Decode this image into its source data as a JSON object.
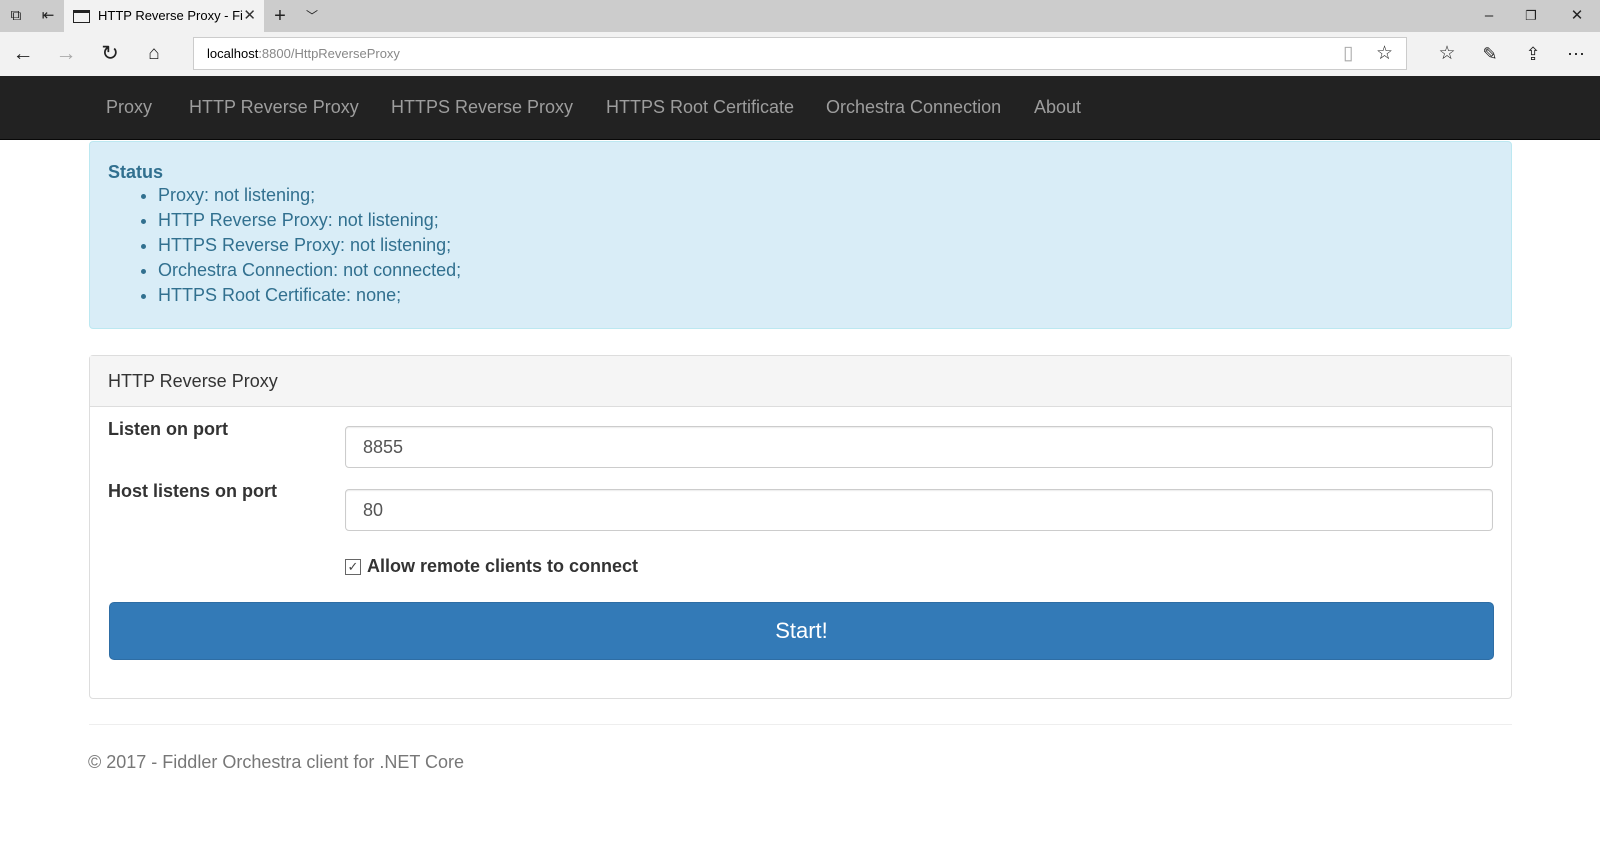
{
  "browser": {
    "tab_title": "HTTP Reverse Proxy - Fi",
    "url_host": "localhost",
    "url_rest": ":8800/HttpReverseProxy"
  },
  "nav": {
    "items": [
      "Proxy",
      "HTTP Reverse Proxy",
      "HTTPS Reverse Proxy",
      "HTTPS Root Certificate",
      "Orchestra Connection",
      "About"
    ]
  },
  "status": {
    "title": "Status",
    "items": [
      "Proxy: not listening;",
      "HTTP Reverse Proxy: not listening;",
      "HTTPS Reverse Proxy: not listening;",
      "Orchestra Connection: not connected;",
      "HTTPS Root Certificate: none;"
    ]
  },
  "panel": {
    "title": "HTTP Reverse Proxy",
    "listen_label": "Listen on port",
    "listen_value": "8855",
    "host_label": "Host listens on port",
    "host_value": "80",
    "allow_remote_label": "Allow remote clients to connect",
    "allow_remote_checked": true,
    "start_label": "Start!"
  },
  "footer": {
    "text": "© 2017 - Fiddler Orchestra client for .NET Core"
  },
  "colors": {
    "navbar": "#222222",
    "alert_bg": "#d9edf7",
    "alert_text": "#31708f",
    "primary": "#337ab7"
  }
}
